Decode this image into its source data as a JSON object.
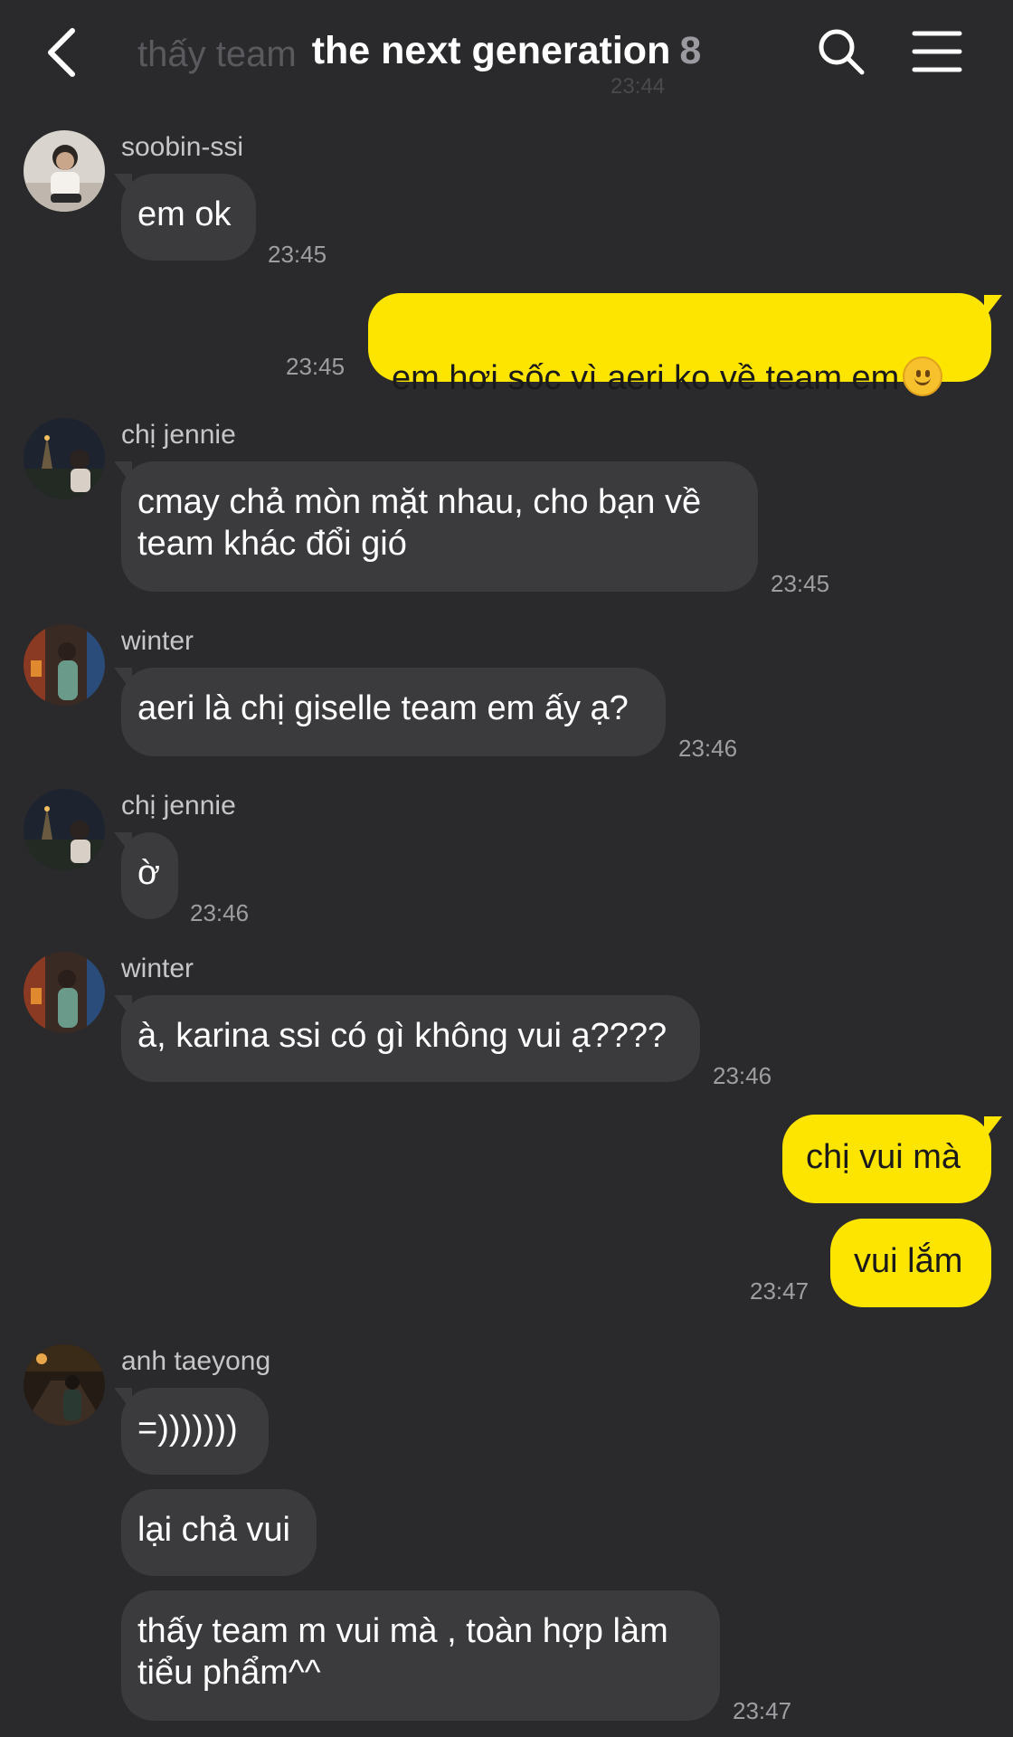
{
  "header": {
    "ghost_previous_text": "thấy team",
    "ghost_previous_time": "23:44",
    "title": "the next generation",
    "member_count": "8",
    "icons": {
      "back": "chevron-left-icon",
      "search": "search-icon",
      "menu": "hamburger-menu-icon"
    }
  },
  "colors": {
    "background": "#2a2a2d",
    "incoming_bubble": "#3b3b3e",
    "outgoing_bubble": "#fee500"
  },
  "messages": [
    {
      "sender": "soobin-ssi",
      "text": "em ok",
      "time": "23:45"
    },
    {
      "text": "em hơi sốc vì aeri ko về team em",
      "emoji": "slightly-smiling-face-emoji",
      "time": "23:45"
    },
    {
      "sender": "chị jennie",
      "text": "cmay chả mòn mặt nhau, cho bạn về\nteam khác đổi gió",
      "time": "23:45"
    },
    {
      "sender": "winter",
      "text": "aeri là chị giselle team em ấy ạ?",
      "time": "23:46"
    },
    {
      "sender": "chị jennie",
      "text": "ờ",
      "time": "23:46"
    },
    {
      "sender": "winter",
      "text": "à, karina ssi có gì không vui ạ????",
      "time": "23:46"
    },
    {
      "text": "chị vui mà"
    },
    {
      "text": "vui lắm",
      "time": "23:47"
    },
    {
      "sender": "anh taeyong",
      "text": "=)))))))"
    },
    {
      "text": "lại chả vui"
    },
    {
      "text": "thấy team m vui mà , toàn hợp làm\ntiểu phẩm^^",
      "time": "23:47"
    }
  ]
}
